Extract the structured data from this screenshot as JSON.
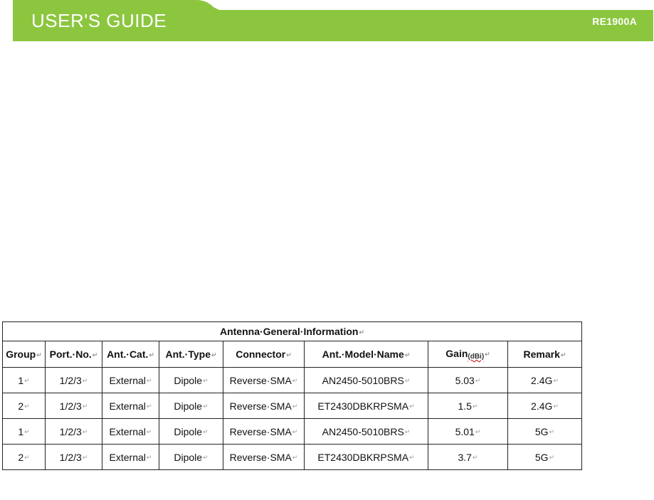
{
  "header": {
    "title": "USER'S GUIDE",
    "model": "RE1900A",
    "color": "#8cc63f"
  },
  "table": {
    "caption": "Antenna·General·Information",
    "columns": [
      "Group",
      "Port.·No.",
      "Ant.·Cat.",
      "Ant.·Type",
      "Connector",
      "Ant.·Model·Name",
      "Gain",
      "Remark"
    ],
    "gain_unit": "(dBi)",
    "rows": [
      [
        "1",
        "1/2/3",
        "External",
        "Dipole",
        "Reverse·SMA",
        "AN2450-5010BRS",
        "5.03",
        "2.4G"
      ],
      [
        "2",
        "1/2/3",
        "External",
        "Dipole",
        "Reverse·SMA",
        "ET2430DBKRPSMA",
        "1.5",
        "2.4G"
      ],
      [
        "1",
        "1/2/3",
        "External",
        "Dipole",
        "Reverse·SMA",
        "AN2450-5010BRS",
        "5.01",
        "5G"
      ],
      [
        "2",
        "1/2/3",
        "External",
        "Dipole",
        "Reverse·SMA",
        "ET2430DBKRPSMA",
        "3.7",
        "5G"
      ]
    ]
  }
}
